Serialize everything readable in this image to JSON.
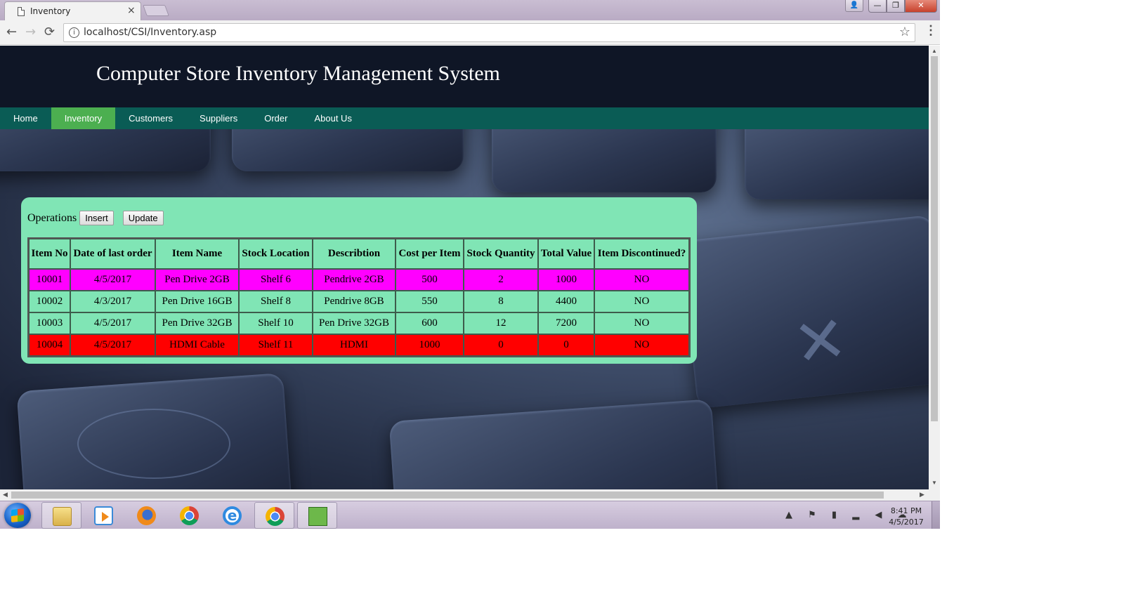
{
  "browser": {
    "tab_title": "Inventory",
    "tab_close": "×",
    "url": "localhost/CSI/Inventory.asp",
    "back_icon": "←",
    "forward_icon": "→",
    "reload_icon": "⟳",
    "info_icon": "i",
    "star_icon": "☆",
    "menu_icon": "⋮",
    "window_min": "—",
    "window_max": "❐",
    "window_close": "✕",
    "user_icon": "👤"
  },
  "site": {
    "title": "Computer Store Inventory Management System",
    "nav": [
      {
        "label": "Home",
        "active": false
      },
      {
        "label": "Inventory",
        "active": true
      },
      {
        "label": "Customers",
        "active": false
      },
      {
        "label": "Suppliers",
        "active": false
      },
      {
        "label": "Order",
        "active": false
      },
      {
        "label": "About Us",
        "active": false
      }
    ]
  },
  "operations": {
    "label": "Operations",
    "insert_label": "Insert",
    "update_label": "Update"
  },
  "inventory_table": {
    "headers": [
      "Item No",
      "Date of last order",
      "Item Name",
      "Stock Location",
      "Describtion",
      "Cost per Item",
      "Stock Quantity",
      "Total Value",
      "Item Discontinued?"
    ],
    "rows": [
      {
        "cells": [
          "10001",
          "4/5/2017",
          "Pen Drive 2GB",
          "Shelf 6",
          "Pendrive 2GB",
          "500",
          "2",
          "1000",
          "NO"
        ],
        "highlight": "magenta"
      },
      {
        "cells": [
          "10002",
          "4/3/2017",
          "Pen Drive 16GB",
          "Shelf 8",
          "Pendrive 8GB",
          "550",
          "8",
          "4400",
          "NO"
        ],
        "highlight": "green"
      },
      {
        "cells": [
          "10003",
          "4/5/2017",
          "Pen Drive 32GB",
          "Shelf 10",
          "Pen Drive 32GB",
          "600",
          "12",
          "7200",
          "NO"
        ],
        "highlight": "green"
      },
      {
        "cells": [
          "10004",
          "4/5/2017",
          "HDMI Cable",
          "Shelf 11",
          "HDMI",
          "1000",
          "0",
          "0",
          "NO"
        ],
        "highlight": "red"
      }
    ]
  },
  "colors": {
    "header_bg": "#0f1626",
    "nav_bg": "#0a5c55",
    "nav_active": "#4caf50",
    "panel_bg": "#80e5b5",
    "row_magenta": "#ff00ff",
    "row_red": "#ff0000"
  },
  "taskbar": {
    "apps": [
      "explorer-icon",
      "media-player-icon",
      "firefox-icon",
      "chrome-icon",
      "internet-explorer-icon",
      "chrome-icon",
      "task-manager-icon"
    ],
    "tray_icons": "▲ ⚑ ▮ ▂ ◀ ☁",
    "time": "8:41 PM",
    "date": "4/5/2017"
  }
}
